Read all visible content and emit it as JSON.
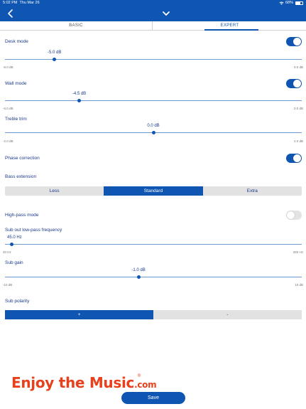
{
  "status_bar": {
    "time": "5:02 PM",
    "date": "Thu Mar 26",
    "battery": "68%",
    "battery_level": 0.68
  },
  "nav": {
    "back_icon": "chevron-left-icon",
    "collapse_icon": "chevron-down-icon"
  },
  "tabs": [
    {
      "label": "BASIC",
      "selected": false
    },
    {
      "label": "EXPERT",
      "selected": true
    }
  ],
  "desk_mode": {
    "label": "Desk mode",
    "enabled": true,
    "value_label": "-5.0 dB",
    "value": -5.0,
    "min": -6.0,
    "max": 0.0,
    "min_label": "-6.0 dB",
    "max_label": "0.0 dB"
  },
  "wall_mode": {
    "label": "Wall mode",
    "enabled": true,
    "value_label": "-4.5 dB",
    "value": -4.5,
    "min": -6.0,
    "max": 0.0,
    "min_label": "-6.0 dB",
    "max_label": "0.0 dB"
  },
  "treble_trim": {
    "label": "Treble trim",
    "value_label": "0.0 dB",
    "value": 0.0,
    "min": -2.0,
    "max": 2.0,
    "min_label": "-2.0 dB",
    "max_label": "2.0 dB"
  },
  "phase_correction": {
    "label": "Phase correction",
    "enabled": true
  },
  "bass_extension": {
    "label": "Bass extension",
    "options": [
      "Less",
      "Standard",
      "Extra"
    ],
    "selected": "Standard"
  },
  "high_pass_mode": {
    "label": "High-pass mode",
    "enabled": false
  },
  "sub_lowpass": {
    "label": "Sub out low-pass frequency",
    "value_label": "45.0 Hz",
    "value": 45.0,
    "min": 40,
    "max": 250,
    "min_label": "40 Hz",
    "max_label": "250 Hz"
  },
  "sub_gain": {
    "label": "Sub gain",
    "value_label": "-1.0 dB",
    "value": -1.0,
    "min": -10,
    "max": 10,
    "min_label": "-10 dB",
    "max_label": "10 dB"
  },
  "sub_polarity": {
    "label": "Sub polarity",
    "options": [
      "+",
      "-"
    ],
    "selected": "+"
  },
  "watermark": {
    "main": "Enjoy the Music",
    "suffix": ".com",
    "reg": "®"
  },
  "save_label": "Save",
  "colors": {
    "accent": "#0f56b3",
    "label": "#1a3a8a",
    "watermark": "#e8401c"
  }
}
